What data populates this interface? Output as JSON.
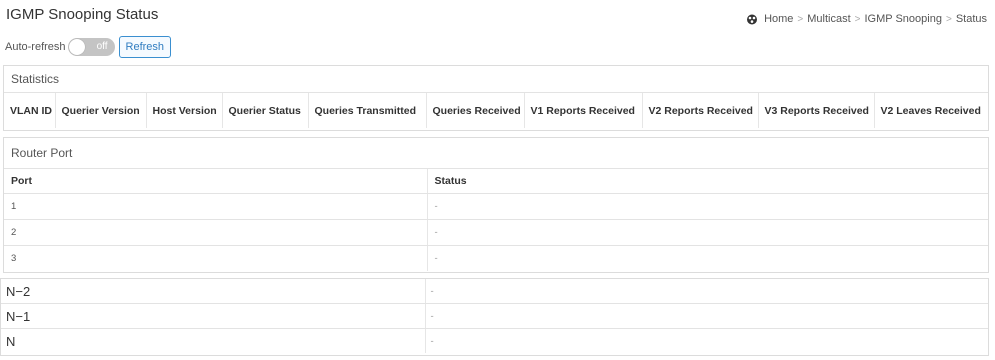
{
  "page": {
    "title": "IGMP Snooping Status"
  },
  "breadcrumb": [
    "Home",
    "Multicast",
    "IGMP Snooping",
    "Status"
  ],
  "controls": {
    "auto_refresh_label": "Auto-refresh",
    "toggle_state": "off",
    "refresh_label": "Refresh"
  },
  "statistics": {
    "title": "Statistics",
    "columns": [
      "VLAN ID",
      "Querier Version",
      "Host Version",
      "Querier Status",
      "Queries Transmitted",
      "Queries Received",
      "V1 Reports Received",
      "V2 Reports Received",
      "V3 Reports Received",
      "V2 Leaves Received"
    ]
  },
  "router_port": {
    "title": "Router Port",
    "columns": [
      "Port",
      "Status"
    ],
    "rows": [
      {
        "port": "1",
        "status": "-"
      },
      {
        "port": "2",
        "status": "-"
      },
      {
        "port": "3",
        "status": "-"
      }
    ],
    "lower_rows": [
      {
        "port": "N−2",
        "status": "-"
      },
      {
        "port": "N−1",
        "status": "-"
      },
      {
        "port": "N",
        "status": "-"
      }
    ]
  },
  "colors": {
    "accent": "#2f7cc0",
    "toggle_off": "#c4c4c4",
    "border": "#dcdcdc"
  }
}
